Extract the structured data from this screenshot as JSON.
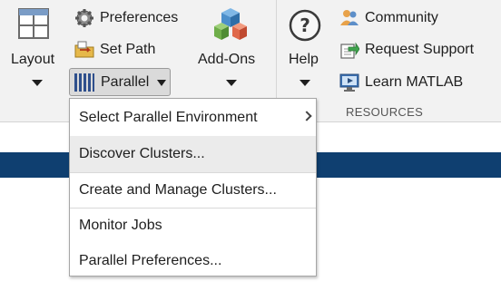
{
  "toolbar": {
    "layout_label": "Layout",
    "preferences_label": "Preferences",
    "set_path_label": "Set Path",
    "parallel_label": "Parallel",
    "addons_label": "Add-Ons",
    "help_label": "Help",
    "community_label": "Community",
    "request_support_label": "Request Support",
    "learn_matlab_label": "Learn MATLAB",
    "resources_group_label": "RESOURCES"
  },
  "icons": {
    "layout": "layout-grid-icon",
    "preferences": "gear-icon",
    "set_path": "folder-path-icon",
    "parallel": "parallel-bars-icon",
    "addons": "cubes-icon",
    "help": "question-icon",
    "community": "people-icon",
    "request_support": "support-arrow-icon",
    "learn_matlab": "monitor-learn-icon"
  },
  "parallel_menu": {
    "items": [
      {
        "label": "Select Parallel Environment",
        "has_submenu": true
      },
      {
        "label": "Discover Clusters...",
        "highlighted": true
      },
      {
        "label": "Create and Manage Clusters..."
      },
      {
        "label": "Monitor Jobs"
      },
      {
        "label": "Parallel Preferences..."
      }
    ]
  },
  "colors": {
    "ribbon_bg": "#f2f2f2",
    "band": "#0f3f70",
    "hover": "#ebebeb",
    "parallel_icon": "#2e4f8c"
  }
}
